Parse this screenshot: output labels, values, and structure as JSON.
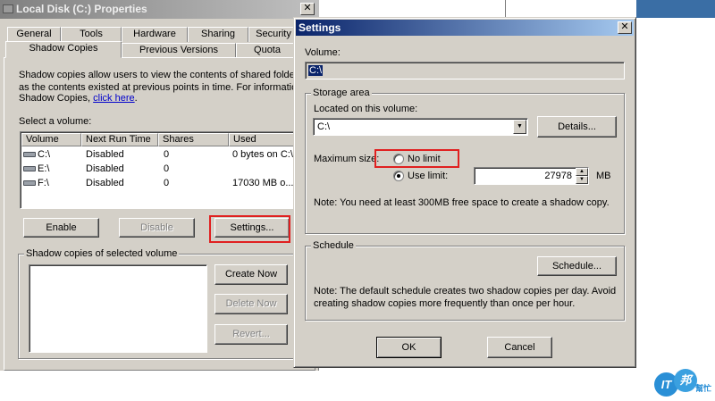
{
  "properties": {
    "title": "Local Disk (C:) Properties",
    "tabs_back": [
      "General",
      "Tools",
      "Hardware",
      "Sharing",
      "Security"
    ],
    "tabs_front": [
      "Shadow Copies",
      "Previous Versions",
      "Quota"
    ],
    "description_line1": "Shadow copies allow users to view the contents of shared folders",
    "description_line2": "as the contents existed at previous points in time. For information on",
    "description_line3": "Shadow Copies,",
    "click_here": "click here",
    "select_volume_label": "Select a volume:",
    "columns": [
      "Volume",
      "Next Run Time",
      "Shares",
      "Used"
    ],
    "rows": [
      {
        "volume": "C:\\",
        "next_run": "Disabled",
        "shares": "0",
        "used": "0 bytes on C:\\"
      },
      {
        "volume": "E:\\",
        "next_run": "Disabled",
        "shares": "0",
        "used": ""
      },
      {
        "volume": "F:\\",
        "next_run": "Disabled",
        "shares": "0",
        "used": "17030 MB o..."
      }
    ],
    "enable_button": "Enable",
    "disable_button": "Disable",
    "settings_button": "Settings...",
    "group_label": "Shadow copies of selected volume",
    "create_now_button": "Create Now",
    "delete_now_button": "Delete Now",
    "revert_button": "Revert...",
    "close_glyph": "✕"
  },
  "settings": {
    "title": "Settings",
    "close_glyph": "✕",
    "volume_label": "Volume:",
    "volume_value": "C:\\",
    "storage_area_label": "Storage area",
    "located_label": "Located on this volume:",
    "located_value": "C:\\",
    "details_button": "Details...",
    "max_size_label": "Maximum size:",
    "no_limit_label": "No limit",
    "use_limit_label": "Use limit:",
    "limit_value": "27978",
    "unit": "MB",
    "note_storage": "Note: You need at least 300MB free space to create a shadow copy.",
    "schedule_label": "Schedule",
    "schedule_button": "Schedule...",
    "note_schedule_line1": "Note: The default schedule creates two shadow copies per day. Avoid",
    "note_schedule_line2": "creating shadow copies more frequently than once per hour.",
    "ok_button": "OK",
    "cancel_button": "Cancel",
    "selected_radio": "use_limit"
  },
  "watermark": {
    "brand_text": "IT",
    "brand_text2": "邦",
    "sub_text": "幫忙"
  },
  "colors": {
    "highlight_red": "#e02020",
    "active_title": "#0a246a",
    "link": "#0000cc"
  }
}
